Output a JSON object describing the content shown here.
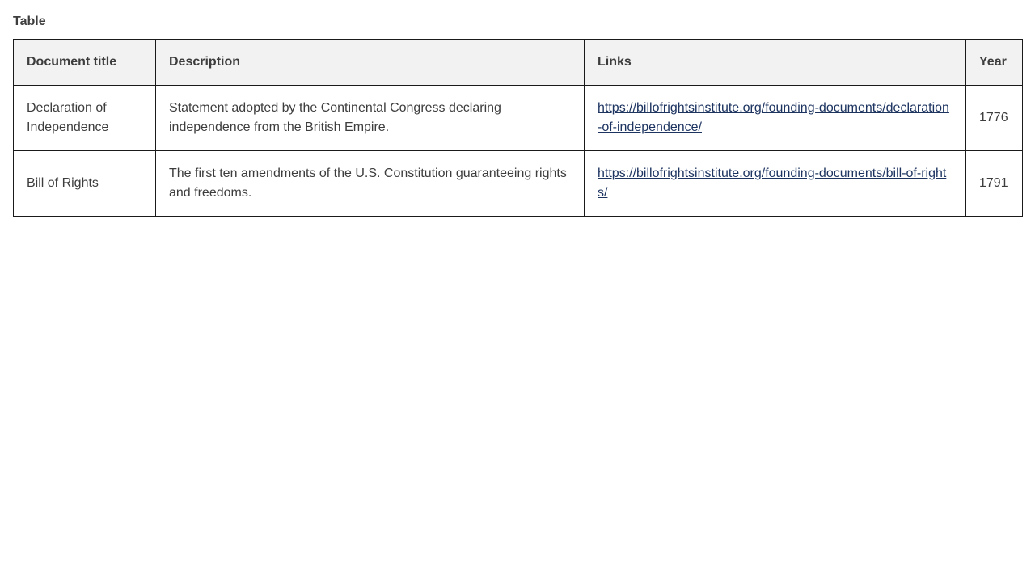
{
  "caption": "Table",
  "table": {
    "headers": {
      "title": "Document title",
      "description": "Description",
      "links": "Links",
      "year": "Year"
    },
    "rows": [
      {
        "title": "Declaration of Independence",
        "description": "Statement adopted by the Continental Congress declaring independence from the British Empire.",
        "link": "https://billofrightsinstitute.org/founding-documents/declaration-of-independence/",
        "year": "1776"
      },
      {
        "title": "Bill of Rights",
        "description": "The first ten amendments of the U.S. Constitution guaranteeing rights and freedoms.",
        "link": "https://billofrightsinstitute.org/founding-documents/bill-of-rights/",
        "year": "1791"
      }
    ]
  },
  "colors": {
    "text": "#3d3d3d",
    "link": "#1d3461",
    "header_bg": "#f2f2f2",
    "border": "#1a1a1a"
  }
}
